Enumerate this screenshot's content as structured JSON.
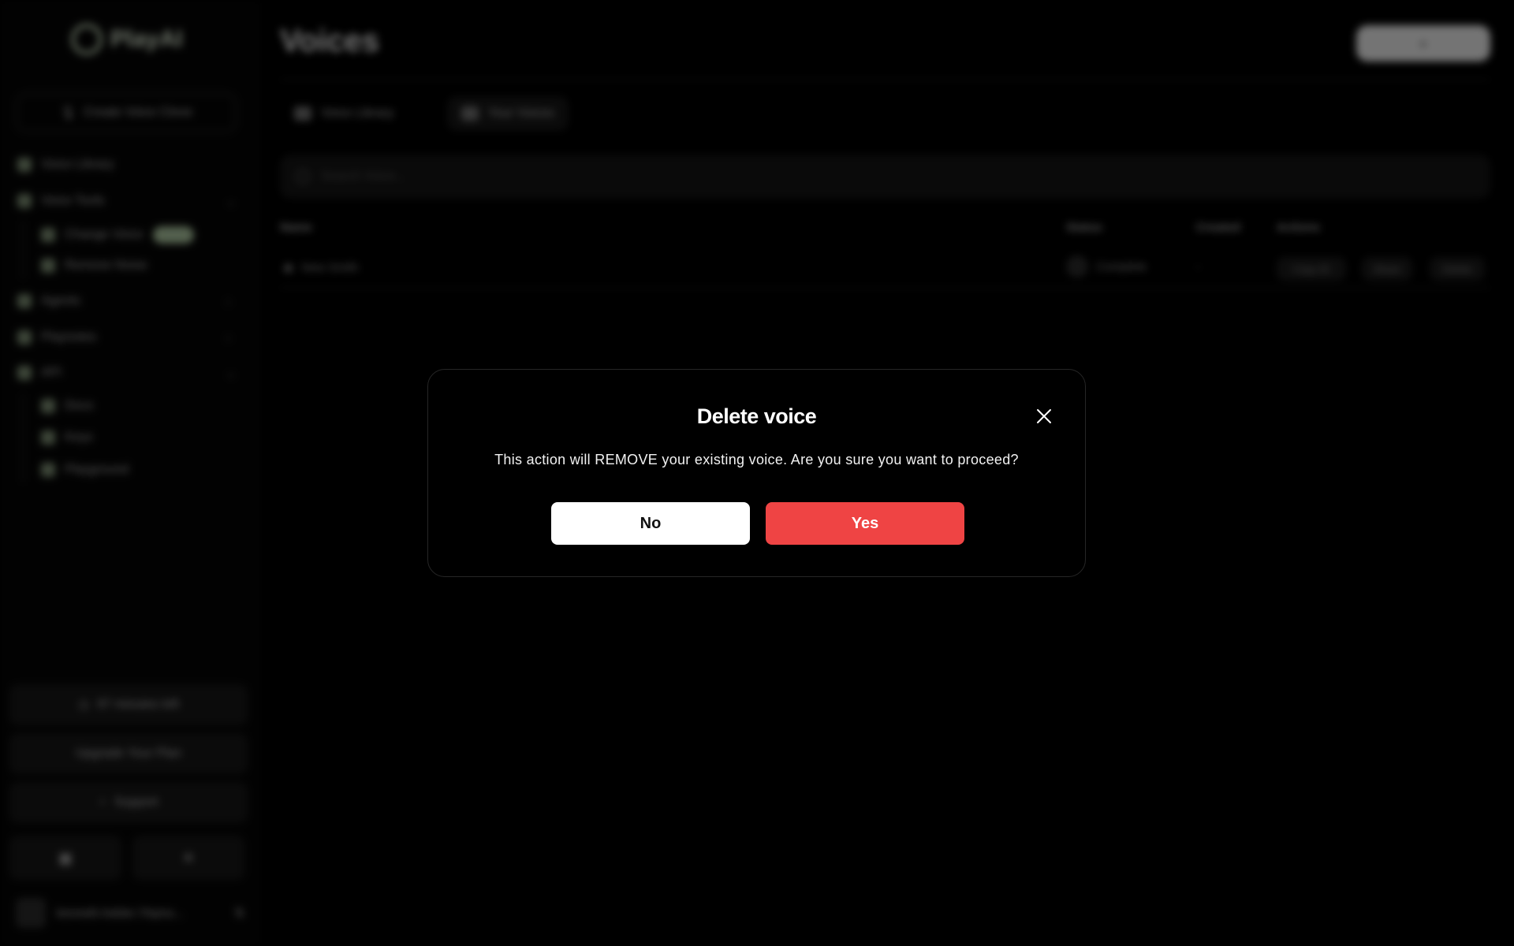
{
  "brand": {
    "logo_text": "PlayAI",
    "accent_color": "#a7c09b"
  },
  "sidebar": {
    "create_clone_label": "Create Voice Clone",
    "items": [
      {
        "label": "Voice Library"
      },
      {
        "label": "Voice Tools",
        "children": [
          {
            "label": "Change Voice"
          },
          {
            "label": "Remove Noise"
          }
        ]
      },
      {
        "label": "Agents"
      },
      {
        "label": "Playnotes"
      },
      {
        "label": "API",
        "children": [
          {
            "label": "Docs"
          },
          {
            "label": "Keys"
          },
          {
            "label": "Playground"
          }
        ]
      }
    ],
    "minutes_left": "97 minutes left",
    "upgrade_label": "Upgrade Your Plan",
    "support_label": "Support",
    "user_name": "kenneth.hebler.70qmo..."
  },
  "main": {
    "title": "Voices",
    "tabs": [
      {
        "label": "Voice Library"
      },
      {
        "label": "Your Voices"
      }
    ],
    "search_placeholder": "Search Voice...",
    "table": {
      "headers": [
        "Name",
        "Status",
        "Created",
        "Actions"
      ],
      "rows": [
        {
          "name": "New Smith",
          "status": "Complete",
          "created": "-",
          "actions": [
            "Copy ID",
            "Share",
            "Delete"
          ]
        }
      ]
    }
  },
  "modal": {
    "title": "Delete voice",
    "message": "This action will REMOVE your existing voice. Are you sure you want to proceed?",
    "no_label": "No",
    "yes_label": "Yes",
    "danger_color": "#ef4444"
  }
}
